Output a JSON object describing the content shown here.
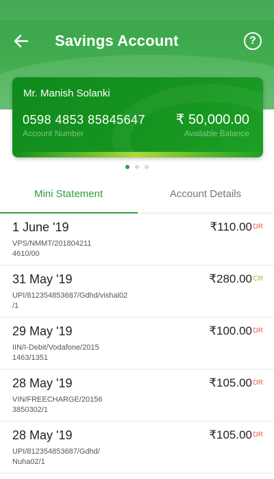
{
  "header": {
    "title": "Savings Account",
    "back_icon": "arrow-left-icon",
    "help_icon": "help-circle-icon",
    "help_glyph": "?"
  },
  "card": {
    "holder_name": "Mr. Manish Solanki",
    "account_number": "0598 4853 85845647",
    "account_number_label": "Account Number",
    "balance": "₹ 50,000.00",
    "balance_label": "Available Balance"
  },
  "pager": {
    "count": 3,
    "active": 0
  },
  "tabs": [
    {
      "label": "Mini Statement",
      "active": true
    },
    {
      "label": "Account Details",
      "active": false
    }
  ],
  "transactions": [
    {
      "date": "1 June '19",
      "desc_line1": "VPS/NMMT/201804211",
      "desc_line2": "4610/00",
      "amount": "₹110.00",
      "type": "DR"
    },
    {
      "date": "31 May '19",
      "desc_line1": "UPI/812354853687/Gdhd/vishal02",
      "desc_line2": "/1",
      "amount": "₹280.00",
      "type": "CR"
    },
    {
      "date": "29 May '19",
      "desc_line1": "IIN/I-Debit/Vodafone/2015",
      "desc_line2": "1463/1351",
      "amount": "₹100.00",
      "type": "DR"
    },
    {
      "date": "28 May '19",
      "desc_line1": "VIN/FREECHARGE/20156",
      "desc_line2": "3850302/1",
      "amount": "₹105.00",
      "type": "DR"
    },
    {
      "date": "28 May '19",
      "desc_line1": "UPI/812354853687/Gdhd/",
      "desc_line2": "Nuha02/1",
      "amount": "₹105.00",
      "type": "DR"
    }
  ],
  "colors": {
    "brand_green": "#41ad4f",
    "card_green": "#16951f",
    "tab_active": "#2f9a3b",
    "debit": "#e55a3a",
    "credit": "#8bbf2f"
  }
}
